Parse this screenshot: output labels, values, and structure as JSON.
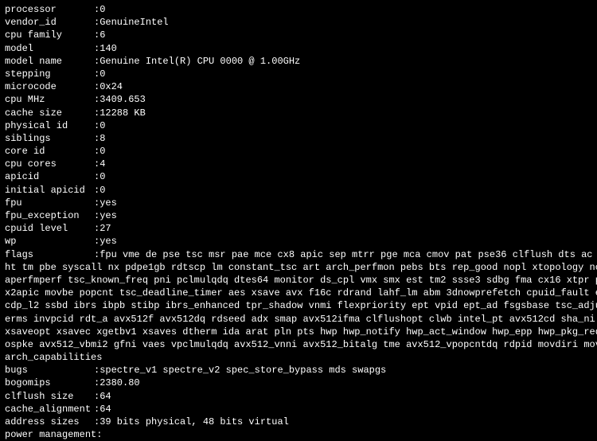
{
  "cpuinfo": {
    "processor": {
      "key": "processor",
      "val": "0"
    },
    "vendor_id": {
      "key": "vendor_id",
      "val": "GenuineIntel"
    },
    "cpu_family": {
      "key": "cpu family",
      "val": "6"
    },
    "model": {
      "key": "model",
      "val": "140"
    },
    "model_name": {
      "key": "model name",
      "val": "Genuine Intel(R) CPU 0000 @ 1.00GHz"
    },
    "stepping": {
      "key": "stepping",
      "val": "0"
    },
    "microcode": {
      "key": "microcode",
      "val": "0x24"
    },
    "cpu_mhz": {
      "key": "cpu MHz",
      "val": "3409.653"
    },
    "cache_size": {
      "key": "cache size",
      "val": "12288 KB"
    },
    "physical_id": {
      "key": "physical id",
      "val": "0"
    },
    "siblings": {
      "key": "siblings",
      "val": "8"
    },
    "core_id": {
      "key": "core id",
      "val": "0"
    },
    "cpu_cores": {
      "key": "cpu cores",
      "val": "4"
    },
    "apicid": {
      "key": "apicid",
      "val": "0"
    },
    "initial_apicid": {
      "key": "initial apicid",
      "val": "0"
    },
    "fpu": {
      "key": "fpu",
      "val": "yes"
    },
    "fpu_exception": {
      "key": "fpu_exception",
      "val": "yes"
    },
    "cpuid_level": {
      "key": "cpuid level",
      "val": "27"
    },
    "wp": {
      "key": "wp",
      "val": "yes"
    },
    "flags": {
      "key": "flags",
      "lines": [
        "fpu vme de pse tsc msr pae mce cx8 apic sep mtrr pge mca cmov pat pse36 clflush dts ac",
        "ht tm pbe syscall nx pdpe1gb rdtscp lm constant_tsc art arch_perfmon pebs bts rep_good nopl xtopology no",
        "aperfmperf tsc_known_freq pni pclmulqdq dtes64 monitor ds_cpl vmx smx est tm2 ssse3 sdbg fma cx16 xtpr p",
        "x2apic movbe popcnt tsc_deadline_timer aes xsave avx f16c rdrand lahf_lm abm 3dnowprefetch cpuid_fault e",
        "cdp_l2 ssbd ibrs ibpb stibp ibrs_enhanced tpr_shadow vnmi flexpriority ept vpid ept_ad fsgsbase tsc_adju",
        "erms invpcid rdt_a avx512f avx512dq rdseed adx smap avx512ifma clflushopt clwb intel_pt avx512cd sha_ni",
        "xsaveopt xsavec xgetbv1 xsaves dtherm ida arat pln pts hwp hwp_notify hwp_act_window hwp_epp hwp_pkg_req",
        "ospke avx512_vbmi2 gfni vaes vpclmulqdq avx512_vnni avx512_bitalg tme avx512_vpopcntdq rdpid movdiri mov",
        "arch_capabilities"
      ]
    },
    "bugs": {
      "key": "bugs",
      "val": "spectre_v1 spectre_v2 spec_store_bypass mds swapgs"
    },
    "bogomips": {
      "key": "bogomips",
      "val": "2380.80"
    },
    "clflush_size": {
      "key": "clflush size",
      "val": "64"
    },
    "cache_alignment": {
      "key": "cache_alignment",
      "val": "64"
    },
    "address_sizes": {
      "key": "address sizes",
      "val": "39 bits physical, 48 bits virtual"
    },
    "power_management": {
      "key": "power management:",
      "val": ""
    }
  }
}
